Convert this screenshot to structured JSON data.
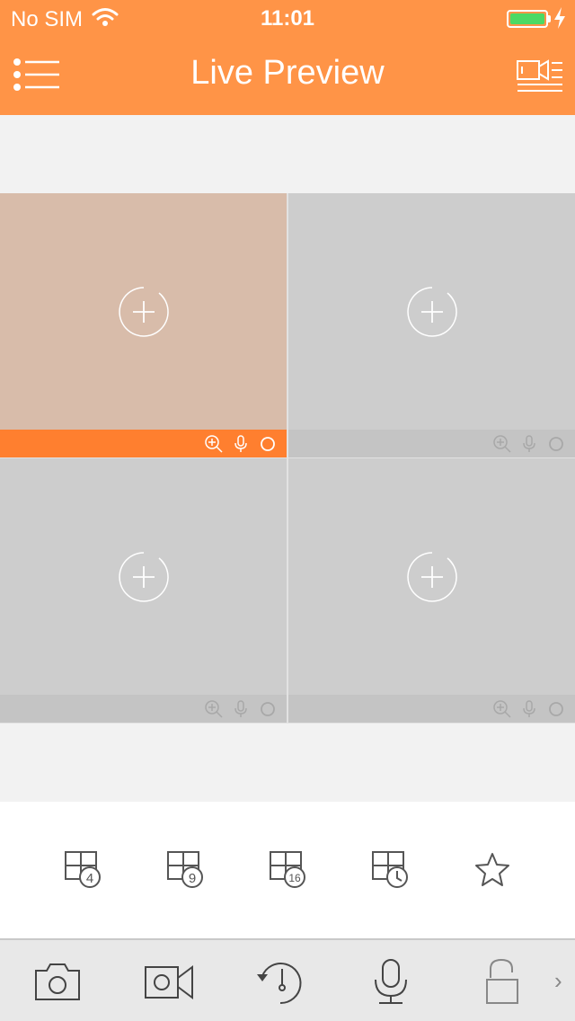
{
  "status_bar": {
    "carrier": "No SIM",
    "time": "11:01",
    "battery_color": "#4cd964"
  },
  "header": {
    "title": "Live Preview",
    "background": "#ff9447",
    "left_icon": "menu-list-icon",
    "right_icon": "device-list-icon"
  },
  "grid": {
    "cells": [
      {
        "active": true,
        "add_icon": "add-circle-icon",
        "controls": [
          "zoom-icon",
          "microphone-icon",
          "record-circle-icon"
        ]
      },
      {
        "active": false,
        "add_icon": "add-circle-icon",
        "controls": [
          "zoom-icon",
          "microphone-icon",
          "record-circle-icon"
        ]
      },
      {
        "active": false,
        "add_icon": "add-circle-icon",
        "controls": [
          "zoom-icon",
          "microphone-icon",
          "record-circle-icon"
        ]
      },
      {
        "active": false,
        "add_icon": "add-circle-icon",
        "controls": [
          "zoom-icon",
          "microphone-icon",
          "record-circle-icon"
        ]
      }
    ],
    "active_color": "#ff7f2f"
  },
  "layouts": {
    "buttons": [
      {
        "badge": "4",
        "icon": "grid-4-icon"
      },
      {
        "badge": "9",
        "icon": "grid-9-icon"
      },
      {
        "badge": "16",
        "icon": "grid-16-icon"
      },
      {
        "badge": "",
        "icon": "grid-schedule-icon"
      },
      {
        "badge": "",
        "icon": "favorite-star-icon"
      }
    ]
  },
  "toolbar": {
    "items": [
      "camera-snapshot-icon",
      "video-record-icon",
      "playback-icon",
      "microphone-icon",
      "unlock-icon"
    ],
    "more": "›"
  }
}
